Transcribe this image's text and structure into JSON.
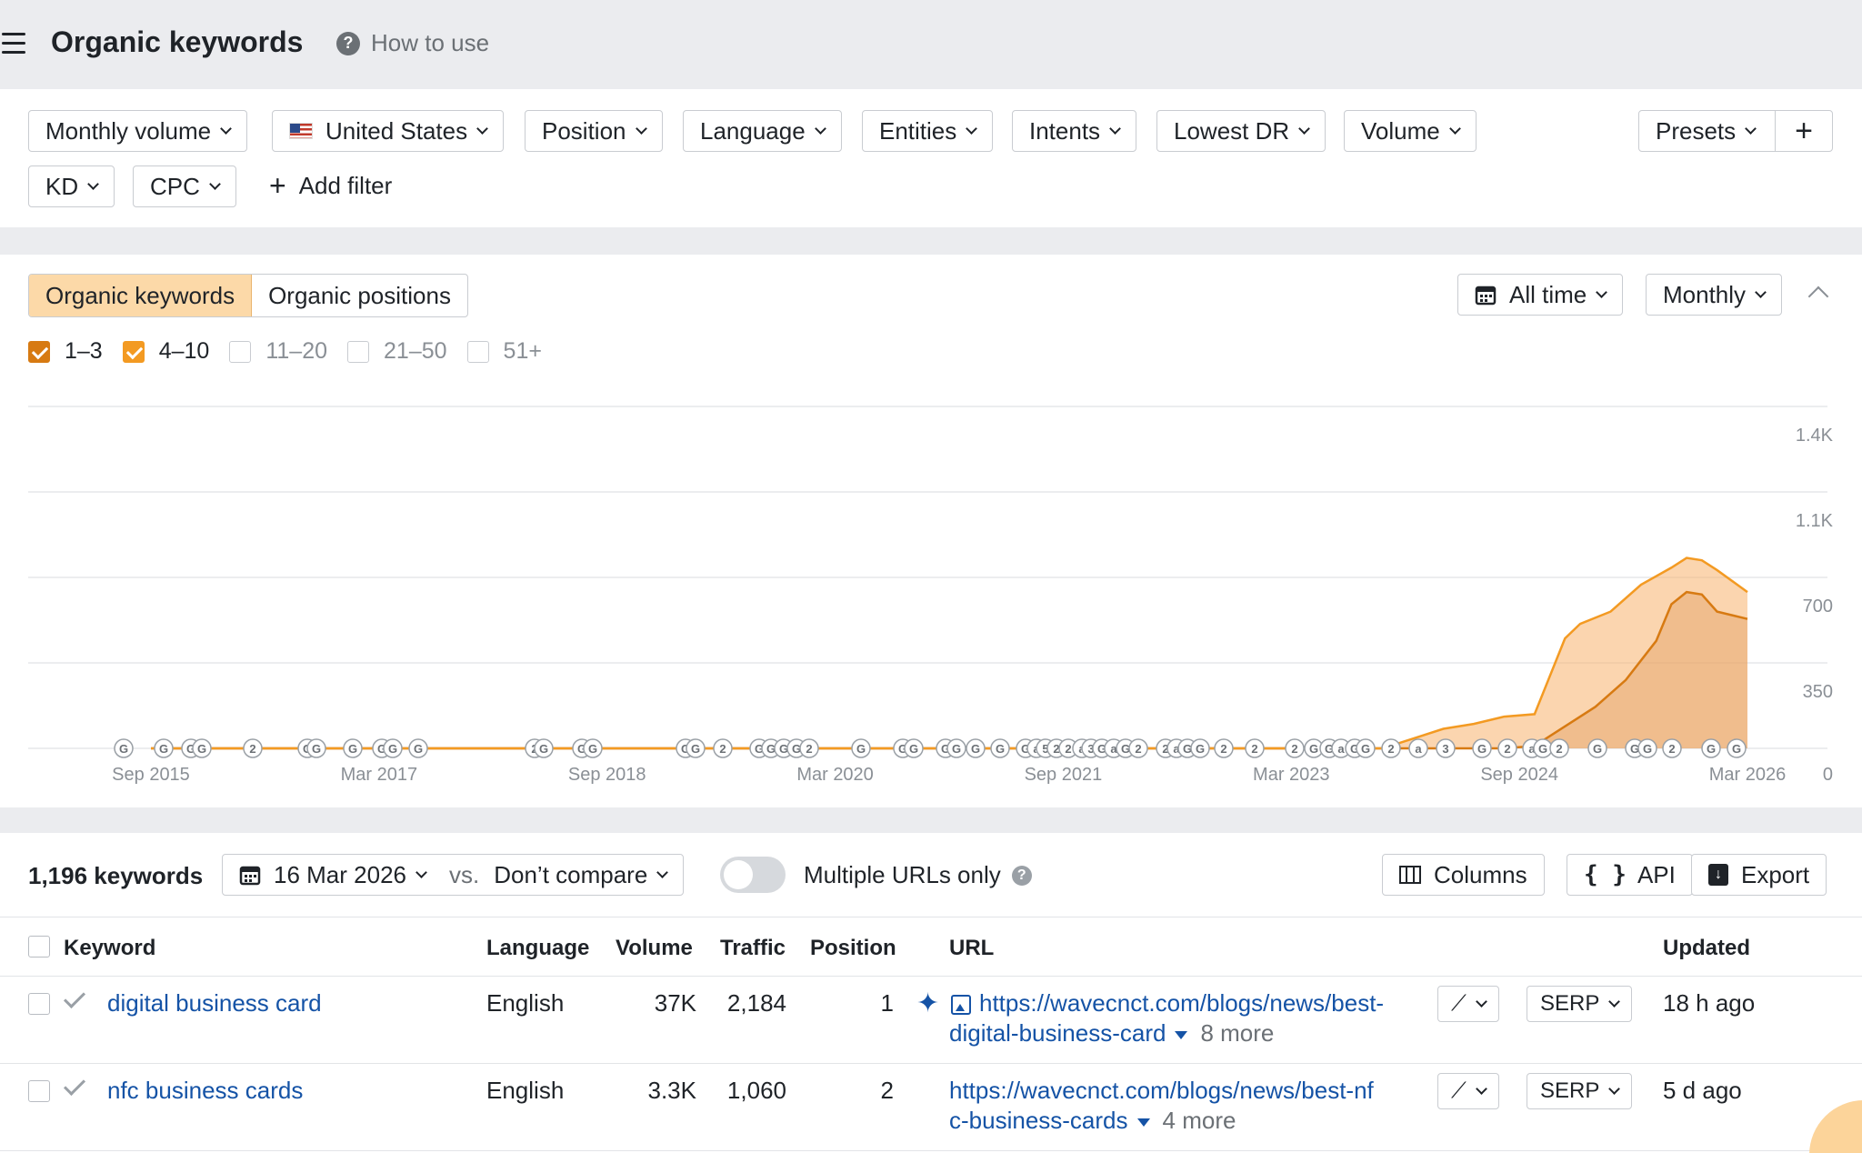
{
  "header": {
    "title": "Organic keywords",
    "how_to_use": "How to use"
  },
  "filters": {
    "row1": [
      "Monthly volume",
      "United States",
      "Position",
      "Language",
      "Entities",
      "Intents",
      "Lowest DR",
      "Volume"
    ],
    "row2": [
      "KD",
      "CPC"
    ],
    "add_filter": "Add filter",
    "presets": "Presets",
    "plus": "+"
  },
  "chart_controls": {
    "tabs": [
      "Organic keywords",
      "Organic positions"
    ],
    "active_tab": "Organic keywords",
    "range": "All time",
    "interval": "Monthly",
    "position_ranges": [
      {
        "label": "1–3",
        "checked": true,
        "color": "#d77a12"
      },
      {
        "label": "4–10",
        "checked": true,
        "color": "#f39a22"
      },
      {
        "label": "11–20",
        "checked": false
      },
      {
        "label": "21–50",
        "checked": false
      },
      {
        "label": "51+",
        "checked": false
      }
    ]
  },
  "chart_data": {
    "type": "area",
    "x_ticks": [
      "Sep 2015",
      "Mar 2017",
      "Sep 2018",
      "Mar 2020",
      "Sep 2021",
      "Mar 2023",
      "Sep 2024",
      "Mar 2026"
    ],
    "y_ticks": [
      "1.4K",
      "1.1K",
      "700",
      "350",
      "0"
    ],
    "ylim": [
      0,
      1400
    ],
    "stacked": true,
    "series": [
      {
        "name": "1–3",
        "color": "#d77a12",
        "points": [
          [
            2015.7,
            0
          ],
          [
            2023.8,
            0
          ],
          [
            2024.6,
            0
          ],
          [
            2024.8,
            10
          ],
          [
            2025.0,
            90
          ],
          [
            2025.2,
            170
          ],
          [
            2025.4,
            280
          ],
          [
            2025.6,
            440
          ],
          [
            2025.7,
            590
          ],
          [
            2025.8,
            640
          ],
          [
            2025.9,
            630
          ],
          [
            2026.0,
            560
          ],
          [
            2026.2,
            530
          ]
        ]
      },
      {
        "name": "4–10",
        "color": "#f39a22",
        "points": [
          [
            2015.7,
            0
          ],
          [
            2023.8,
            0
          ],
          [
            2023.9,
            20
          ],
          [
            2024.0,
            40
          ],
          [
            2024.2,
            80
          ],
          [
            2024.4,
            100
          ],
          [
            2024.6,
            130
          ],
          [
            2024.8,
            140
          ],
          [
            2025.0,
            450
          ],
          [
            2025.1,
            510
          ],
          [
            2025.3,
            560
          ],
          [
            2025.5,
            670
          ],
          [
            2025.7,
            740
          ],
          [
            2025.8,
            780
          ],
          [
            2025.9,
            770
          ],
          [
            2026.0,
            730
          ],
          [
            2026.2,
            640
          ]
        ]
      }
    ],
    "annotation_markers": "G/2/3/a event icons along the baseline"
  },
  "table_toolbar": {
    "keyword_count": "1,196 keywords",
    "date": "16 Mar 2026",
    "vs": "vs.",
    "compare": "Don’t compare",
    "multiple_urls": "Multiple URLs only",
    "help": "?",
    "columns": "Columns",
    "api": "API",
    "api_icon": "{ }",
    "export": "Export"
  },
  "table": {
    "columns": [
      "Keyword",
      "Language",
      "Volume",
      "Traffic",
      "Position",
      "URL",
      "Updated"
    ],
    "rows": [
      {
        "keyword": "digital business card",
        "language": "English",
        "volume": "37K",
        "traffic": "2,184",
        "position": "1",
        "url_line1": "https://wavecnct.com/blogs/news/best-",
        "url_line2": "digital-business-card",
        "more": "8 more",
        "serp": "SERP",
        "updated": "18 h ago"
      },
      {
        "keyword": "nfc business cards",
        "language": "English",
        "volume": "3.3K",
        "traffic": "1,060",
        "position": "2",
        "url_line1": "https://wavecnct.com/blogs/news/best-nf",
        "url_line2": "c-business-cards",
        "more": "4 more",
        "serp": "SERP",
        "updated": "5 d ago"
      }
    ]
  }
}
